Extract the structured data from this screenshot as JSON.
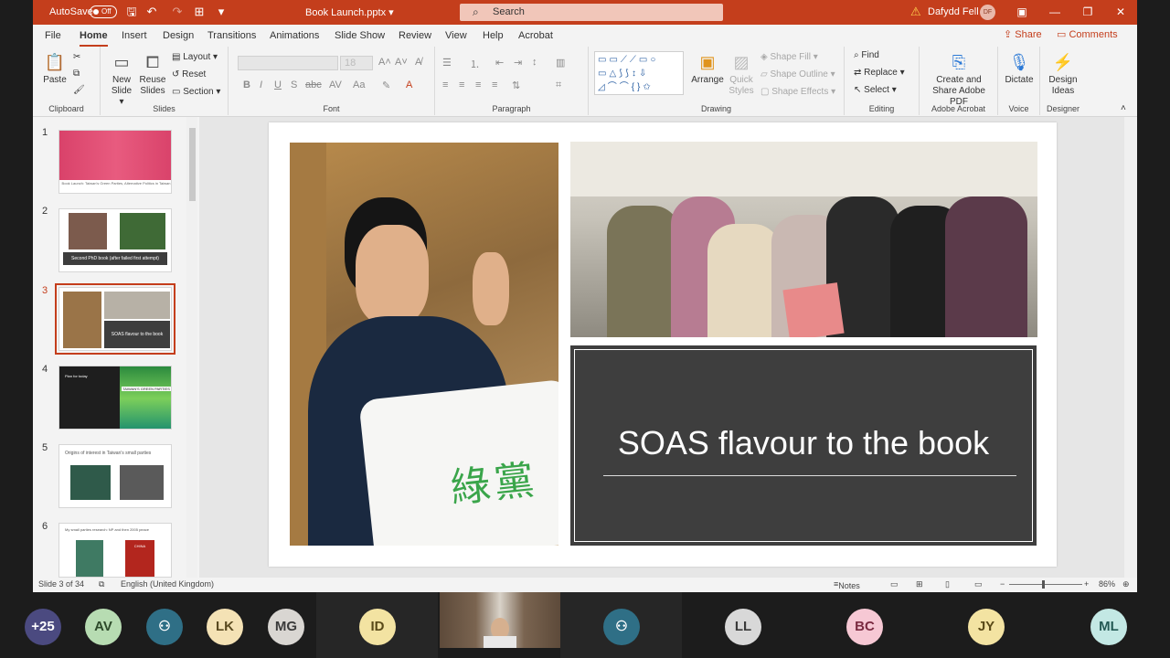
{
  "titlebar": {
    "autosave_label": "AutoSave",
    "autosave_state": "Off",
    "document_title": "Book Launch.pptx ▾",
    "search_placeholder": "Search",
    "user_name": "Dafydd Fell",
    "user_initials": "DF"
  },
  "menu": {
    "items": [
      "File",
      "Home",
      "Insert",
      "Design",
      "Transitions",
      "Animations",
      "Slide Show",
      "Review",
      "View",
      "Help",
      "Acrobat"
    ],
    "active": "Home",
    "share": "Share",
    "comments": "Comments"
  },
  "ribbon": {
    "clipboard": {
      "paste": "Paste",
      "label": "Clipboard"
    },
    "slides": {
      "new_slide": "New Slide ▾",
      "reuse": "Reuse Slides",
      "layout": "Layout ▾",
      "reset": "Reset",
      "section": "Section ▾",
      "label": "Slides"
    },
    "font": {
      "label": "Font",
      "size": "18"
    },
    "paragraph": {
      "label": "Paragraph"
    },
    "drawing": {
      "arrange": "Arrange",
      "quick_styles": "Quick Styles",
      "shape_fill": "Shape Fill ▾",
      "shape_outline": "Shape Outline ▾",
      "shape_effects": "Shape Effects ▾",
      "label": "Drawing"
    },
    "editing": {
      "find": "Find",
      "replace": "Replace ▾",
      "select": "Select ▾",
      "label": "Editing"
    },
    "acrobat": {
      "create": "Create and Share Adobe PDF",
      "label": "Adobe Acrobat"
    },
    "voice": {
      "dictate": "Dictate",
      "label": "Voice"
    },
    "designer": {
      "ideas": "Design Ideas",
      "label": "Designer"
    }
  },
  "thumbnails": [
    {
      "num": "1",
      "caption": "Book Launch: Taiwan's Green Parties, Alternative Politics in Taiwan"
    },
    {
      "num": "2",
      "caption": "Second PhD book (after failed first attempt)"
    },
    {
      "num": "3",
      "caption": "SOAS flavour to the book"
    },
    {
      "num": "4",
      "caption": "Plan for today",
      "subcaption": "TAIWAN'S GREEN PARTIES"
    },
    {
      "num": "5",
      "caption": "Origins of interest in Taiwan's small parties"
    },
    {
      "num": "6",
      "caption": "My small parties research: NP and then 2005 peace",
      "subcaption": "CHINA"
    }
  ],
  "slide": {
    "title": "SOAS flavour to the book",
    "tote_text": "綠黨"
  },
  "status": {
    "slide_info": "Slide 3 of 34",
    "language": "English (United Kingdom)",
    "notes": "Notes",
    "zoom": "86%"
  },
  "participants": [
    {
      "label": "+25",
      "bg": "#4b4a80",
      "fg": "#ffffff"
    },
    {
      "label": "AV",
      "bg": "#b7dcb2",
      "fg": "#2d4a2a"
    },
    {
      "label": "",
      "bg": "#2f6f86",
      "fg": "#ffffff",
      "icon": "person-icon"
    },
    {
      "label": "LK",
      "bg": "#f4e2b5",
      "fg": "#5a4a20"
    },
    {
      "label": "MG",
      "bg": "#d9d6d2",
      "fg": "#3a3a3a"
    },
    {
      "label": "ID",
      "bg": "#f3e3a2",
      "fg": "#5a4a18"
    },
    {
      "label": "",
      "bg": "#2f6f86",
      "fg": "#ffffff",
      "icon": "person-icon"
    },
    {
      "label": "LL",
      "bg": "#d8d8d8",
      "fg": "#3a3a3a"
    },
    {
      "label": "BC",
      "bg": "#f6c8d4",
      "fg": "#7a2a40"
    },
    {
      "label": "JY",
      "bg": "#f3e3a2",
      "fg": "#5a4a18"
    },
    {
      "label": "ML",
      "bg": "#c3e8e4",
      "fg": "#245a55"
    }
  ]
}
